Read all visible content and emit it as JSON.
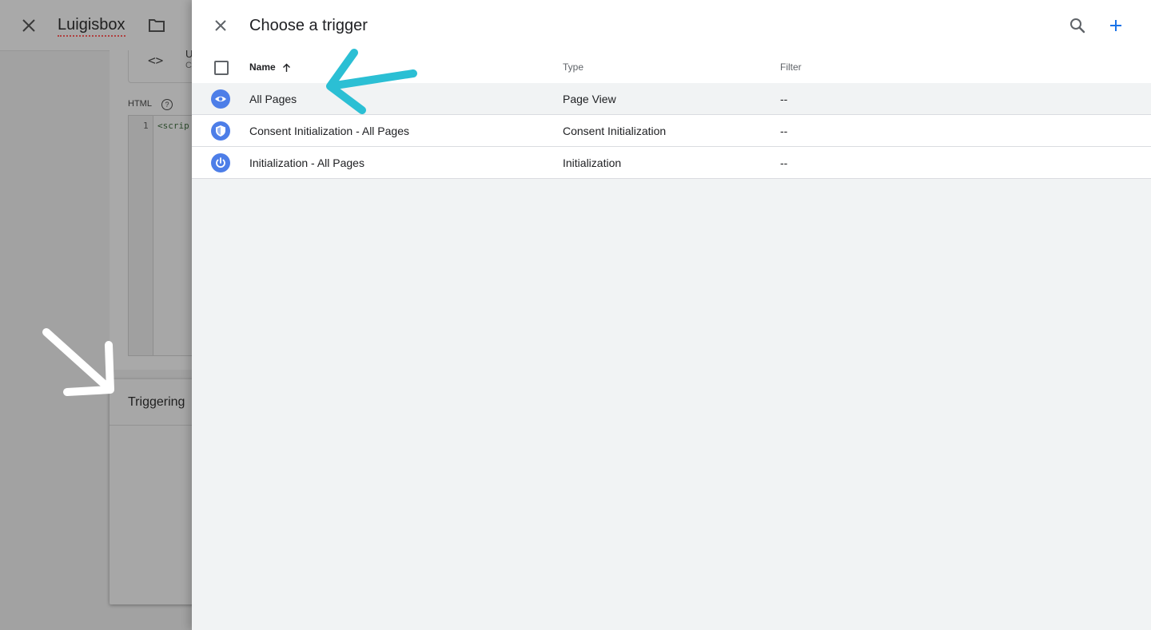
{
  "background": {
    "title": "Luigisbox",
    "type_name_fragment": "U",
    "type_desc_fragment": "C",
    "code_icon": "<>",
    "html_label": "HTML",
    "help_glyph": "?",
    "line_number": "1",
    "code_fragment": "<scrip",
    "triggering_label": "Triggering"
  },
  "panel": {
    "title": "Choose a trigger",
    "columns": {
      "name": "Name",
      "type": "Type",
      "filter": "Filter"
    },
    "rows": [
      {
        "name": "All Pages",
        "type": "Page View",
        "filter": "--",
        "icon": "eye-icon"
      },
      {
        "name": "Consent Initialization - All Pages",
        "type": "Consent Initialization",
        "filter": "--",
        "icon": "shield-icon"
      },
      {
        "name": "Initialization - All Pages",
        "type": "Initialization",
        "filter": "--",
        "icon": "power-icon"
      }
    ]
  },
  "colors": {
    "accent": "#1a73e8",
    "trigger_icon_bg": "#4d7ee8",
    "annotation_arrow": "#2bbfd4"
  }
}
